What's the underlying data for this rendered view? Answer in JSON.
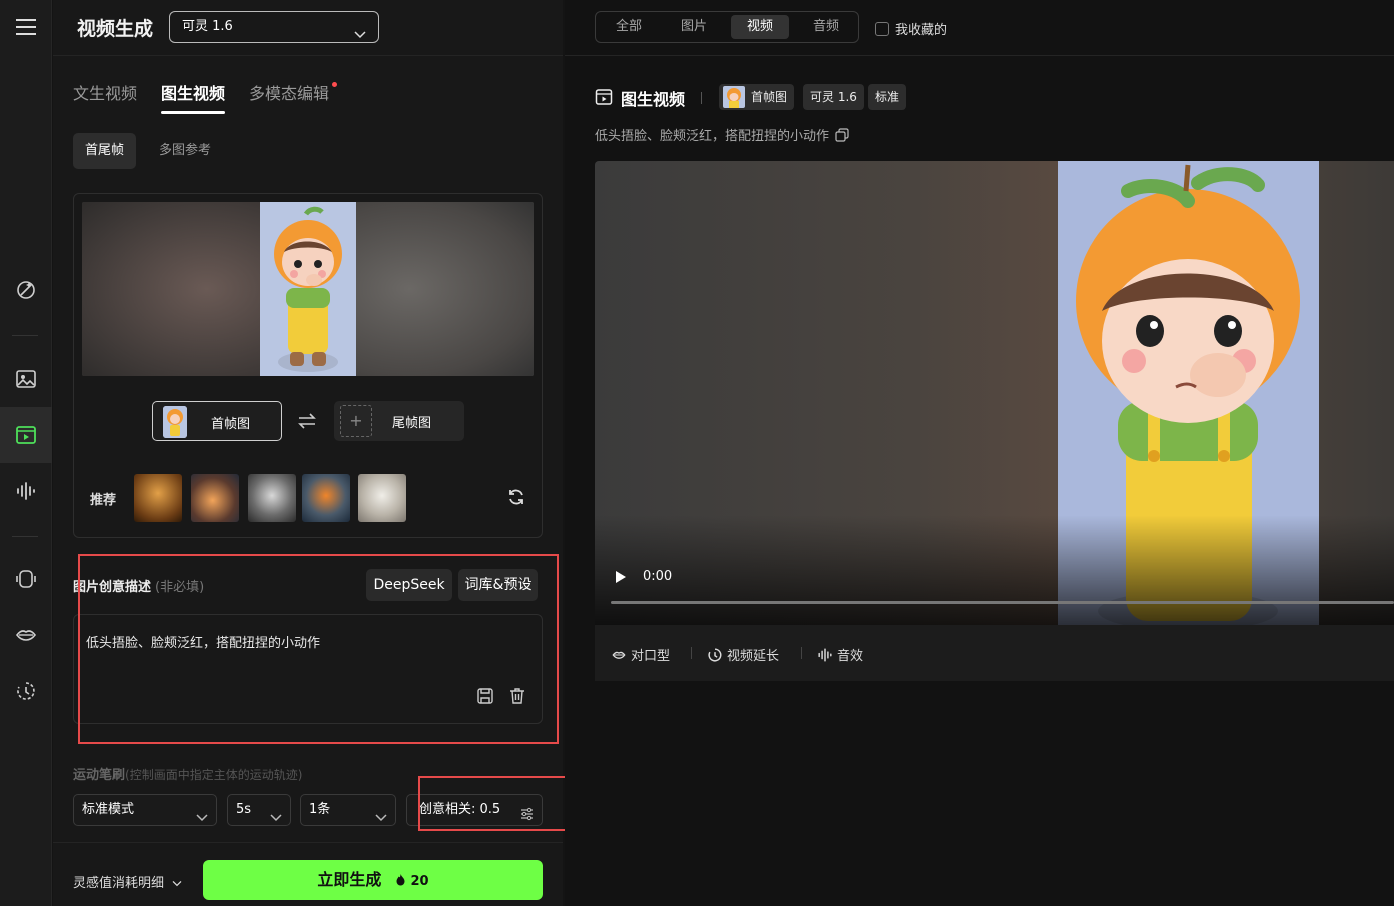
{
  "sidebar": {
    "items": [
      {
        "icon": "menu-icon"
      },
      {
        "icon": "magic-wand-icon"
      },
      {
        "icon": "image-icon"
      },
      {
        "icon": "video-icon",
        "active": true
      },
      {
        "icon": "audio-wave-icon"
      },
      {
        "icon": "model-icon"
      },
      {
        "icon": "lips-icon"
      },
      {
        "icon": "history-icon"
      }
    ]
  },
  "header": {
    "title": "视频生成",
    "model_select": "可灵 1.6"
  },
  "tabs": [
    {
      "label": "文生视频"
    },
    {
      "label": "图生视频",
      "active": true
    },
    {
      "label": "多模态编辑",
      "badge_dot": true
    }
  ],
  "subtabs": [
    {
      "label": "首尾帧",
      "active": true
    },
    {
      "label": "多图参考"
    }
  ],
  "upload": {
    "first_frame_label": "首帧图",
    "last_frame_label": "尾帧图",
    "recommend_label": "推荐"
  },
  "prompt": {
    "heading": "图片创意描述",
    "optional": "(非必填)",
    "deepseek_label": "DeepSeek",
    "presets_label": "词库&预设",
    "text": "低头捂脸、脸颊泛红，搭配扭捏的小动作"
  },
  "motion": {
    "label": "运动笔刷",
    "sub": "(控制画面中指定主体的运动轨迹)"
  },
  "options": {
    "mode": "标准模式",
    "duration": "5s",
    "count": "1条",
    "creativity": "创意相关: 0.5"
  },
  "footer": {
    "cost_label": "灵感值消耗明细",
    "generate_label": "立即生成",
    "generate_cost": "20"
  },
  "filter": {
    "segments": [
      {
        "label": "全部"
      },
      {
        "label": "图片"
      },
      {
        "label": "视频",
        "active": true
      },
      {
        "label": "音频"
      }
    ],
    "favorites_label": "我收藏的"
  },
  "result": {
    "title": "图生视频",
    "frame_tag": "首帧图",
    "model_tag": "可灵 1.6",
    "quality_tag": "标准",
    "prompt": "低头捂脸、脸颊泛红，搭配扭捏的小动作",
    "time": "0:00",
    "actions": [
      {
        "label": "对口型",
        "icon": "lips-icon"
      },
      {
        "label": "视频延长",
        "icon": "extend-icon"
      },
      {
        "label": "音效",
        "icon": "audio-wave-icon"
      }
    ]
  },
  "colors": {
    "accent_green": "#6eff45",
    "highlight_red": "#e64a4a",
    "rail_active": "#4ee05a"
  }
}
